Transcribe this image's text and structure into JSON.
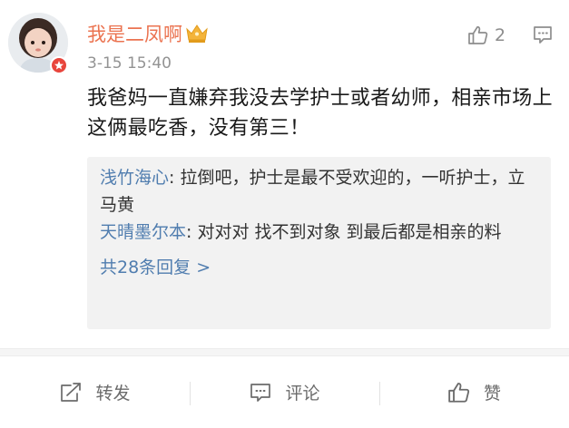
{
  "post": {
    "username": "我是二凤啊",
    "timestamp": "3-15 15:40",
    "like_count": "2",
    "text": "我爸妈一直嫌弃我没去学护士或者幼师，相亲市场上这俩最吃香，没有第三！"
  },
  "replies": [
    {
      "author": "浅竹海心",
      "separator": ": ",
      "text": "拉倒吧，护士是最不受欢迎的，一听护士，立马黄"
    },
    {
      "author": "天晴墨尔本",
      "separator": ": ",
      "text": "对对对 找不到对象 到最后都是相亲的料"
    }
  ],
  "more_replies": "共28条回复 >",
  "actions": {
    "repost": "转发",
    "comment": "评论",
    "like": "赞"
  },
  "icons": {
    "crown": "crown-icon",
    "thumb": "thumbs-up-icon",
    "comment": "comment-bubble-icon",
    "repost": "share-arrow-icon",
    "badge": "vip-badge-icon"
  },
  "colors": {
    "username": "#eb7350",
    "link": "#507daf",
    "text": "#1a1a1a",
    "meta": "#939393",
    "reply_bg": "#f2f2f2"
  }
}
